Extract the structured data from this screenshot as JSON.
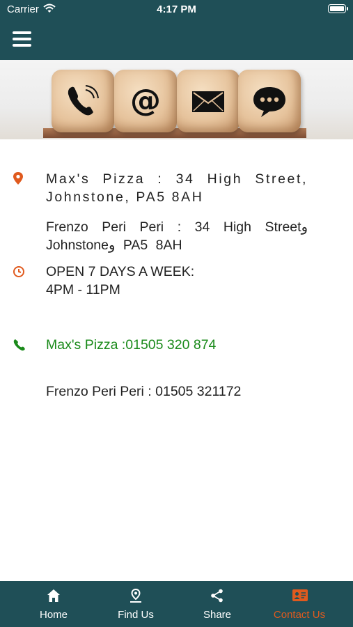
{
  "status_bar": {
    "carrier": "Carrier",
    "time": "4:17 PM"
  },
  "header": {
    "menu_icon": "hamburger-menu-icon"
  },
  "banner": {
    "icons": [
      "phone-icon",
      "at-sign-icon",
      "envelope-icon",
      "chat-bubble-icon"
    ]
  },
  "contact": {
    "address_1": "Max's Pizza : 34 High Street, Johnstone, PA5 8AH",
    "address_2": "Frenzo Peri Peri : 34 High Streetو Johnstoneو PA5 8AH",
    "hours_line1": "OPEN 7 DAYS A WEEK:",
    "hours_line2": "4PM - 11PM",
    "phone_1": "Max's Pizza :01505 320 874",
    "phone_2": "Frenzo Peri Peri : 01505 321172"
  },
  "tabs": [
    {
      "label": "Home",
      "icon": "home-icon"
    },
    {
      "label": "Find Us",
      "icon": "location-pin-icon"
    },
    {
      "label": "Share",
      "icon": "share-icon"
    },
    {
      "label": "Contact Us",
      "icon": "contact-card-icon",
      "active": true
    }
  ],
  "colors": {
    "brand": "#1f4f57",
    "accent": "#e05a1e",
    "phone_green": "#1a8a1a"
  }
}
